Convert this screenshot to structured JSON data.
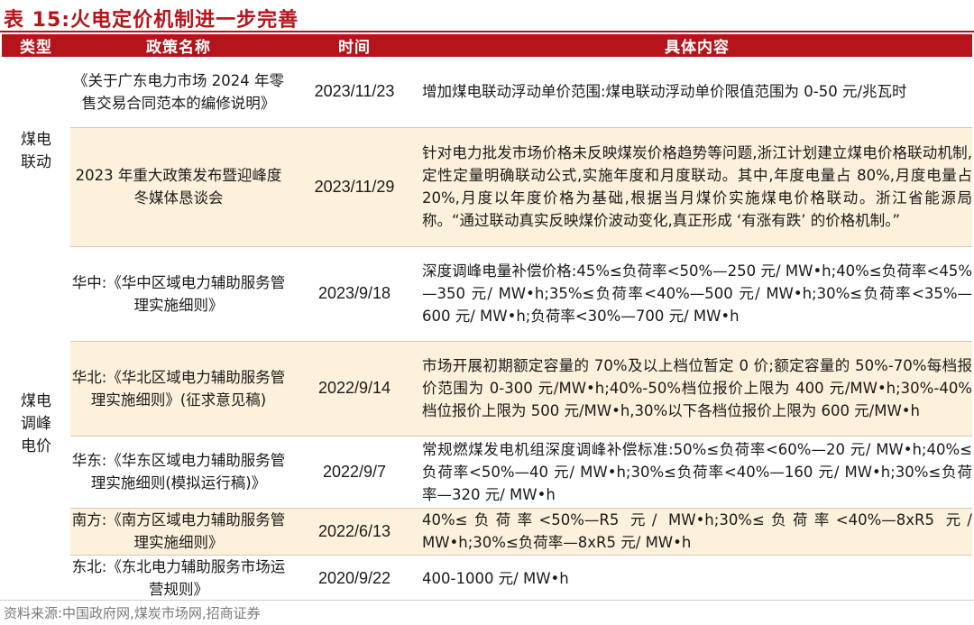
{
  "title": "表 15:火电定价机制进一步完善",
  "columns": [
    "类型",
    "政策名称",
    "时间",
    "具体内容"
  ],
  "groups": [
    {
      "category": "煤电联动",
      "rows": [
        {
          "policy": "《关于广东电力市场 2024 年零售交易合同范本的编修说明》",
          "date": "2023/11/23",
          "detail": "增加煤电联动浮动单价范围:煤电联动浮动单价限值范围为 0-50 元/兆瓦时"
        },
        {
          "policy": "2023 年重大政策发布暨迎峰度冬媒体恳谈会",
          "date": "2023/11/29",
          "detail": "针对电力批发市场价格未反映煤炭价格趋势等问题,浙江计划建立煤电价格联动机制,定性定量明确联动公式,实施年度和月度联动。其中,年度电量占 80%,月度电量占 20%,月度以年度价格为基础,根据当月煤价实施煤电价格联动。浙江省能源局称。“通过联动真实反映煤价波动变化,真正形成 ‘有涨有跌’ 的价格机制。”"
        }
      ]
    },
    {
      "category": "煤电调峰电价",
      "rows": [
        {
          "policy": "华中:《华中区域电力辅助服务管理实施细则》",
          "date": "2023/9/18",
          "detail": "深度调峰电量补偿价格:45%≤负荷率<50%—250 元/ MW•h;40%≤负荷率<45%—350 元/ MW•h;35%≤负荷率<40%—500 元/ MW•h;30%≤负荷率<35%—600 元/ MW•h;负荷率<30%—700 元/ MW•h"
        },
        {
          "policy": "华北:《华北区域电力辅助服务管理实施细则》(征求意见稿)",
          "date": "2022/9/14",
          "detail": "市场开展初期额定容量的 70%及以上档位暂定 0 价;额定容量的 50%-70%每档报价范围为 0-300 元/MW•h;40%-50%档位报价上限为 400 元/MW•h;30%-40%档位报价上限为 500 元/MW•h,30%以下各档位报价上限为 600 元/MW•h"
        },
        {
          "policy": "华东:《华东区域电力辅助服务管理实施细则(模拟运行稿)》",
          "date": "2022/9/7",
          "detail": "常规燃煤发电机组深度调峰补偿标准:50%≤负荷率<60%—20 元/ MW•h;40%≤负荷率<50%—40 元/ MW•h;30%≤负荷率<40%—160 元/ MW•h;30%≤负荷率—320 元/ MW•h"
        },
        {
          "policy": "南方:《南方区域电力辅助服务管理实施细则》",
          "date": "2022/6/13",
          "detail": "40%≤负荷率<50%—R5 元/ MW•h;30%≤负荷率<40%—8xR5 元/ MW•h;30%≤负荷率—8xR5 元/ MW•h"
        },
        {
          "policy": "东北:《东北电力辅助服务市场运营规则》",
          "date": "2020/9/22",
          "detail": "400-1000 元/ MW•h"
        }
      ]
    }
  ],
  "source": "资料来源:中国政府网,煤炭市场网,招商证券"
}
